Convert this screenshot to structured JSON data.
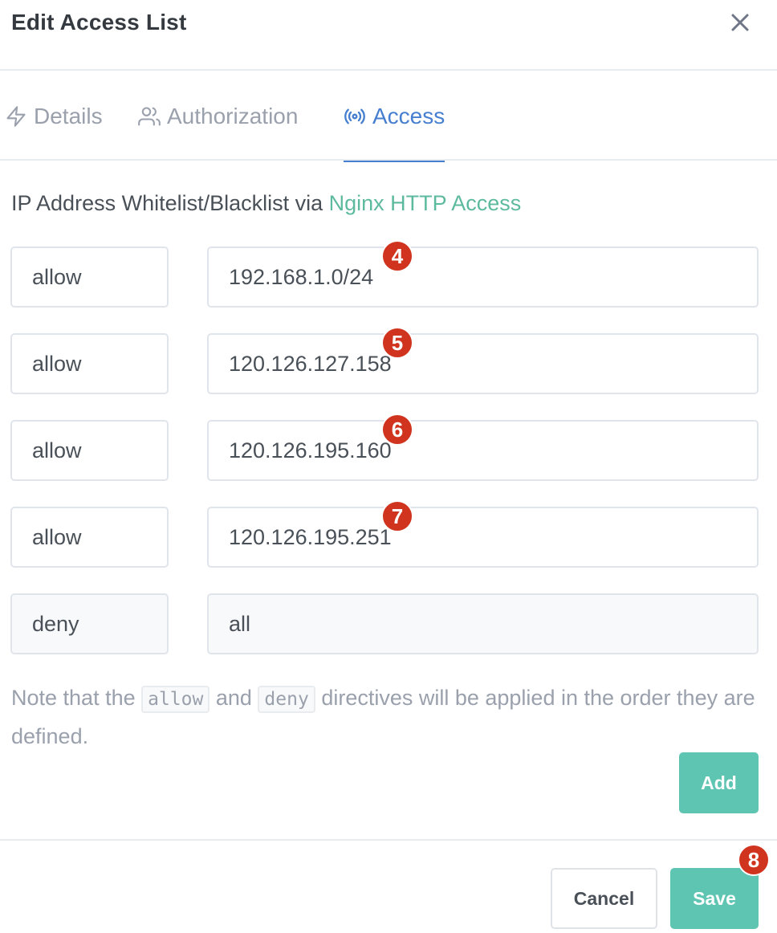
{
  "modal": {
    "title": "Edit Access List"
  },
  "tabs": [
    {
      "label": "Details",
      "icon": "zap-icon"
    },
    {
      "label": "Authorization",
      "icon": "users-icon"
    },
    {
      "label": "Access",
      "icon": "radio-icon",
      "active": true
    }
  ],
  "intro": {
    "text": "IP Address Whitelist/Blacklist via ",
    "link": "Nginx HTTP Access"
  },
  "rules": [
    {
      "directive": "allow",
      "address": "192.168.1.0/24",
      "badge": "4"
    },
    {
      "directive": "allow",
      "address": "120.126.127.158",
      "badge": "5"
    },
    {
      "directive": "allow",
      "address": "120.126.195.160",
      "badge": "6"
    },
    {
      "directive": "allow",
      "address": "120.126.195.251",
      "badge": "7"
    },
    {
      "directive": "deny",
      "address": "all",
      "readonly": true
    }
  ],
  "note": {
    "prefix": "Note that the ",
    "code1": "allow",
    "middle": " and ",
    "code2": "deny",
    "suffix": " directives will be applied in the order they are defined."
  },
  "buttons": {
    "add": "Add",
    "cancel": "Cancel",
    "save": "Save",
    "save_badge": "8"
  },
  "colors": {
    "accent": "#467fcf",
    "link": "#5eba9e",
    "button": "#5fc5b3",
    "badge": "#d0341f"
  }
}
